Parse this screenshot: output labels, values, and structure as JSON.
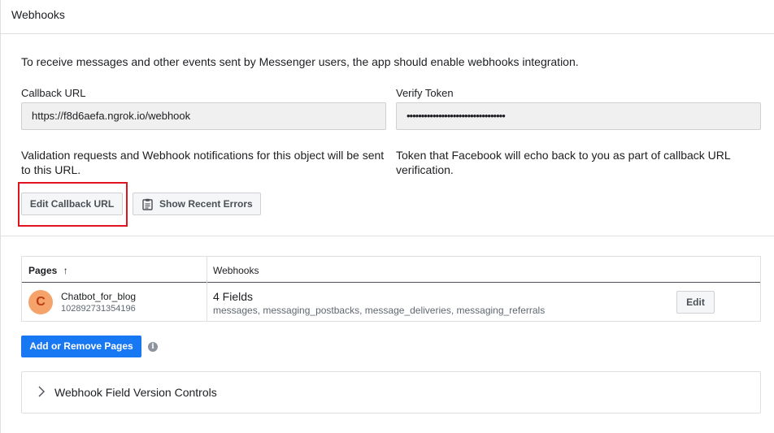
{
  "header": {
    "title": "Webhooks"
  },
  "intro": "To receive messages and other events sent by Messenger users, the app should enable webhooks integration.",
  "callback": {
    "label": "Callback URL",
    "value": "https://f8d6aefa.ngrok.io/webhook",
    "help": "Validation requests and Webhook notifications for this object will be sent to this URL."
  },
  "verify": {
    "label": "Verify Token",
    "value": "••••••••••••••••••••••••••••••••••",
    "help": "Token that Facebook will echo back to you as part of callback URL verification."
  },
  "buttons": {
    "edit_callback": "Edit Callback URL",
    "show_errors": "Show Recent Errors",
    "add_remove": "Add or Remove Pages",
    "edit": "Edit"
  },
  "table": {
    "headers": {
      "pages": "Pages",
      "sort_arrow": "↑",
      "webhooks": "Webhooks"
    },
    "rows": [
      {
        "avatar_letter": "C",
        "page_name": "Chatbot_for_blog",
        "page_id": "102892731354196",
        "fields_title": "4 Fields",
        "fields_list": "messages, messaging_postbacks, message_deliveries, messaging_referrals"
      }
    ]
  },
  "accordion": {
    "title": "Webhook Field Version Controls"
  },
  "colors": {
    "accent": "#1877f2",
    "highlight": "#e0141e"
  }
}
